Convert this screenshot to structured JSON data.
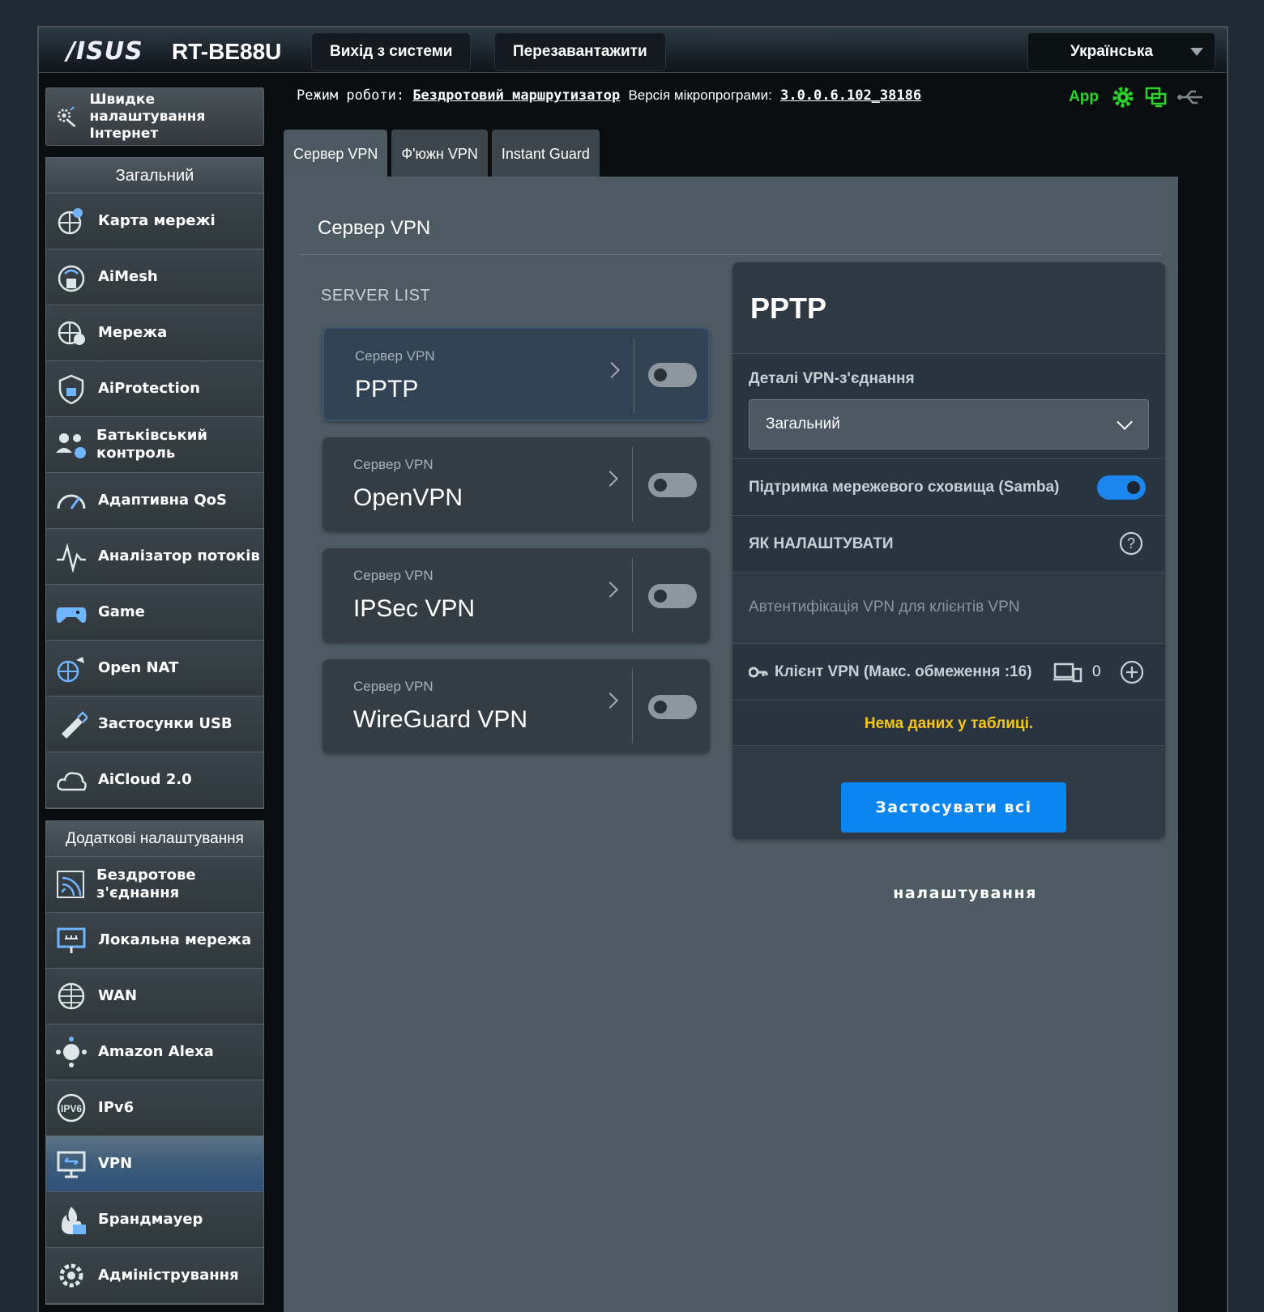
{
  "header": {
    "brand": "/ISUS",
    "model": "RT-BE88U",
    "logout": "Вихід з системи",
    "reboot": "Перезавантажити",
    "language": "Українська"
  },
  "status": {
    "mode_label": "Режим роботи:",
    "mode_value": "Бездротовий маршрутизатор",
    "fw_label": "Версія мікропрограми:",
    "fw_value": "3.0.0.6.102_38186",
    "app_label": "App"
  },
  "sidebar": {
    "quick_setup": "Швидке налаштування Інтернет",
    "general_title": "Загальний",
    "general_items": [
      {
        "label": "Карта мережі",
        "icon": "network-map-icon"
      },
      {
        "label": "AiMesh",
        "icon": "aimesh-icon"
      },
      {
        "label": "Мережа",
        "icon": "guest-network-icon"
      },
      {
        "label": "AiProtection",
        "icon": "aiprotection-icon"
      },
      {
        "label": "Батьківський контроль",
        "icon": "parental-control-icon"
      },
      {
        "label": "Адаптивна QoS",
        "icon": "qos-icon"
      },
      {
        "label": "Аналізатор потоків",
        "icon": "traffic-analyzer-icon"
      },
      {
        "label": "Game",
        "icon": "game-icon"
      },
      {
        "label": "Open NAT",
        "icon": "open-nat-icon"
      },
      {
        "label": "Застосунки USB",
        "icon": "usb-icon"
      },
      {
        "label": "AiCloud 2.0",
        "icon": "aicloud-icon"
      }
    ],
    "advanced_title": "Додаткові налаштування",
    "advanced_items": [
      {
        "label": "Бездротове з'єднання",
        "icon": "wireless-icon"
      },
      {
        "label": "Локальна мережа",
        "icon": "lan-icon"
      },
      {
        "label": "WAN",
        "icon": "wan-icon"
      },
      {
        "label": "Amazon Alexa",
        "icon": "alexa-icon"
      },
      {
        "label": "IPv6",
        "icon": "ipv6-icon"
      },
      {
        "label": "VPN",
        "icon": "vpn-icon"
      },
      {
        "label": "Брандмауер",
        "icon": "firewall-icon"
      },
      {
        "label": "Адміністрування",
        "icon": "admin-icon"
      }
    ]
  },
  "tabs": [
    "Сервер VPN",
    "Ф'южн VPN",
    "Instant Guard"
  ],
  "content": {
    "title": "Сервер VPN",
    "server_list_label": "SERVER LIST",
    "servers": [
      {
        "sub": "Сервер VPN",
        "name": "PPTP",
        "enabled": false
      },
      {
        "sub": "Сервер VPN",
        "name": "OpenVPN",
        "enabled": false
      },
      {
        "sub": "Сервер VPN",
        "name": "IPSec VPN",
        "enabled": false
      },
      {
        "sub": "Сервер VPN",
        "name": "WireGuard VPN",
        "enabled": false
      }
    ]
  },
  "panel": {
    "title": "PPTP",
    "details_label": "Деталі VPN-з'єднання",
    "select_value": "Загальний",
    "samba_label": "Підтримка мережевого сховища (Samba)",
    "samba_enabled": true,
    "howto_label": "ЯК НАЛАШТУВАТИ",
    "auth_label": "Автентифікація VPN для клієнтів VPN",
    "client_label": "Клієнт VPN (Макс. обмеження :16)",
    "client_count": "0",
    "empty_table": "Нема даних у таблиці.",
    "apply_line1": "Застосувати всі",
    "apply_line2": "налаштування"
  },
  "colors": {
    "accent": "#0a85f0",
    "warning_text": "#f5c518",
    "app_green": "#2bd32b"
  }
}
